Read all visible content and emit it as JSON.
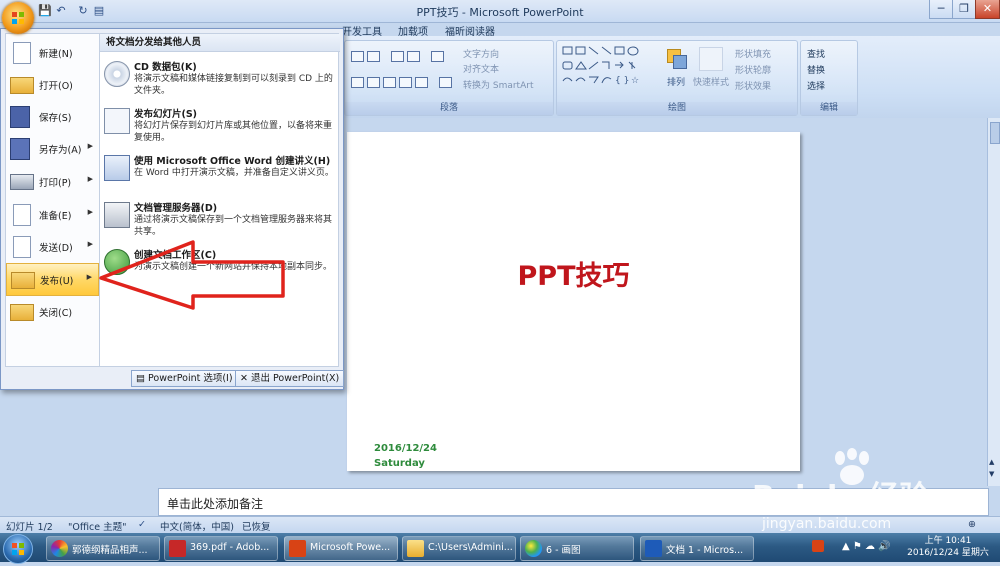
{
  "window": {
    "title": "PPT技巧 - Microsoft PowerPoint",
    "controls": [
      "─",
      "❐",
      "✕"
    ]
  },
  "quick_access": [
    "save-icon",
    "undo-icon",
    "redo-icon",
    "print-preview-icon"
  ],
  "ribbon_tabs": [
    "开发工具",
    "加载项",
    "福昕阅读器"
  ],
  "ribbon": {
    "paragraph": {
      "label": "段落",
      "text_direction": "文字方向",
      "align_text": "对齐文本",
      "convert_smartart": "转换为 SmartArt"
    },
    "drawing": {
      "label": "绘图",
      "arrange": "排列",
      "quick_styles": "快速样式",
      "shape_fill": "形状填充",
      "shape_outline": "形状轮廓",
      "shape_effects": "形状效果"
    },
    "editing": {
      "label": "编辑",
      "find": "查找",
      "replace": "替换",
      "select": "选择"
    }
  },
  "office_menu": {
    "items": [
      {
        "label": "新建(N)",
        "icon": "new-doc-icon",
        "has_arrow": false
      },
      {
        "label": "打开(O)",
        "icon": "open-folder-icon",
        "has_arrow": false
      },
      {
        "label": "保存(S)",
        "icon": "save-icon",
        "has_arrow": false
      },
      {
        "label": "另存为(A)",
        "icon": "save-as-icon",
        "has_arrow": true
      },
      {
        "label": "打印(P)",
        "icon": "print-icon",
        "has_arrow": true
      },
      {
        "label": "准备(E)",
        "icon": "prepare-icon",
        "has_arrow": true
      },
      {
        "label": "发送(D)",
        "icon": "send-icon",
        "has_arrow": true
      },
      {
        "label": "发布(U)",
        "icon": "publish-icon",
        "has_arrow": true,
        "active": true
      },
      {
        "label": "关闭(C)",
        "icon": "close-folder-icon",
        "has_arrow": false
      }
    ],
    "submenu": {
      "title": "将文档分发给其他人员",
      "items": [
        {
          "title": "CD 数据包(K)",
          "desc": "将演示文稿和媒体链接复制到可以刻录到 CD 上的文件夹。",
          "icon": "cd-icon"
        },
        {
          "title": "发布幻灯片(S)",
          "desc": "将幻灯片保存到幻灯片库或其他位置，以备将来重复使用。",
          "icon": "publish-slides-icon"
        },
        {
          "title": "使用 Microsoft Office Word 创建讲义(H)",
          "desc": "在 Word 中打开演示文稿，并准备自定义讲义页。",
          "icon": "word-handout-icon"
        },
        {
          "title": "文档管理服务器(D)",
          "desc": "通过将演示文稿保存到一个文档管理服务器来将其共享。",
          "icon": "server-icon"
        },
        {
          "title": "创建文档工作区(C)",
          "desc": "为演示文稿创建一个新网站并保持本地副本同步。",
          "icon": "workspace-icon"
        }
      ]
    },
    "options_button": "PowerPoint 选项(I)",
    "exit_button": "退出 PowerPoint(X)"
  },
  "slide": {
    "title": "PPT技巧",
    "date": "2016/12/24",
    "day": "Saturday"
  },
  "notes_placeholder": "单击此处添加备注",
  "status": {
    "slide": "幻灯片 1/2",
    "theme": "\"Office 主题\"",
    "language": "中文(简体，中国)",
    "recovered": "已恢复"
  },
  "taskbar": {
    "tasks": [
      {
        "label": "郭德纲精品相声...",
        "icon": "player-icon"
      },
      {
        "label": "369.pdf - Adob...",
        "icon": "pdf-icon"
      },
      {
        "label": "Microsoft Powe...",
        "icon": "powerpoint-icon",
        "active": true
      },
      {
        "label": "C:\\Users\\Admini...",
        "icon": "explorer-icon"
      },
      {
        "label": "6 - 画图",
        "icon": "paint-icon"
      },
      {
        "label": "文档 1 - Micros...",
        "icon": "word-icon"
      }
    ],
    "clock_time": "上午 10:41",
    "clock_date": "2016/12/24 星期六"
  },
  "watermark": {
    "brand": "Bai du 经验",
    "url": "jingyan.baidu.com"
  },
  "colors": {
    "slide_title": "#c0161c",
    "slide_date": "#2e8b3c",
    "arrow": "#e0231c"
  }
}
